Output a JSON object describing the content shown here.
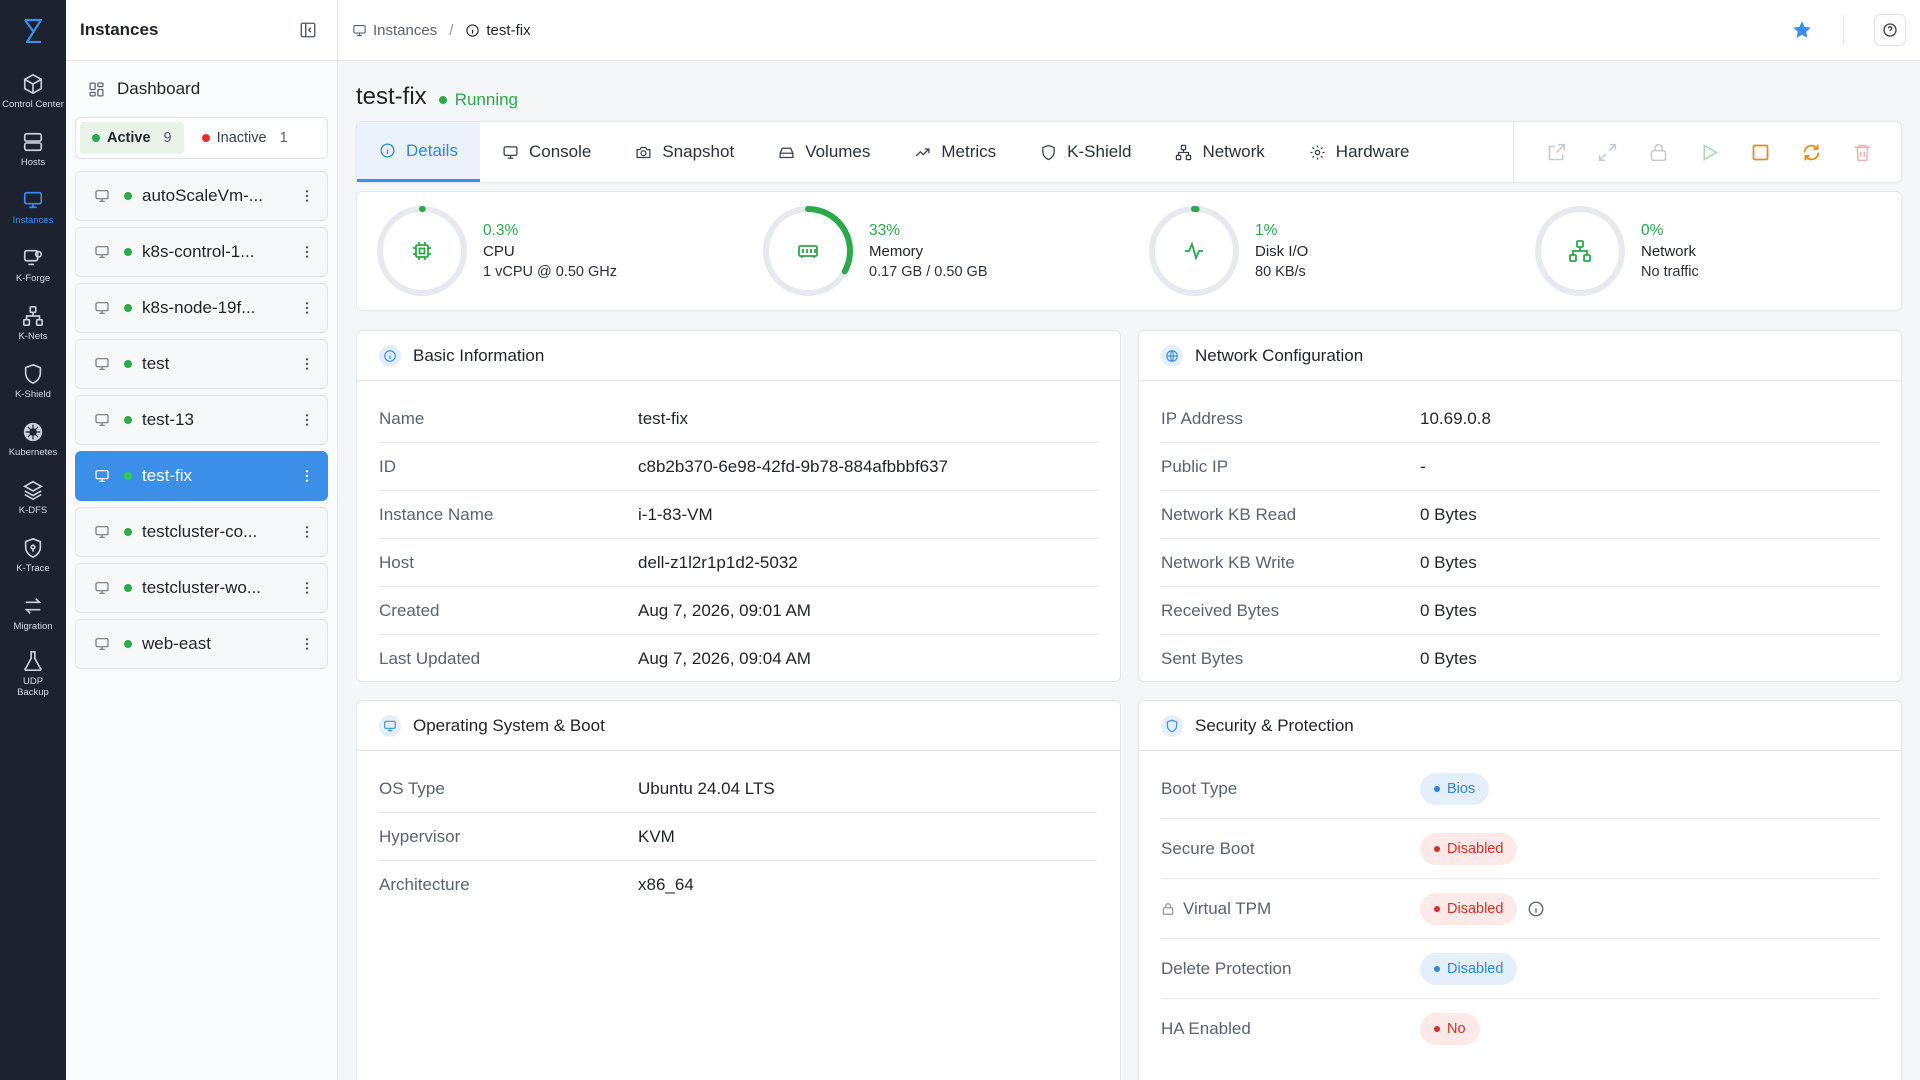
{
  "rail": {
    "items": [
      {
        "label": "Control Center",
        "icon": "cube-icon"
      },
      {
        "label": "Hosts",
        "icon": "server-icon"
      },
      {
        "label": "Instances",
        "icon": "monitor-icon",
        "active": true
      },
      {
        "label": "K-Forge",
        "icon": "forge-icon"
      },
      {
        "label": "K-Nets",
        "icon": "network-icon"
      },
      {
        "label": "K-Shield",
        "icon": "shield-icon"
      },
      {
        "label": "Kubernetes",
        "icon": "kubernetes-icon"
      },
      {
        "label": "K-DFS",
        "icon": "layers-icon"
      },
      {
        "label": "K-Trace",
        "icon": "trace-icon"
      },
      {
        "label": "Migration",
        "icon": "arrows-icon"
      },
      {
        "label": "UDP Backup",
        "icon": "flask-icon"
      }
    ]
  },
  "sidebar": {
    "title": "Instances",
    "dashboard_label": "Dashboard",
    "filters": {
      "active_label": "Active",
      "active_count": "9",
      "inactive_label": "Inactive",
      "inactive_count": "1"
    },
    "instances": [
      {
        "name": "autoScaleVm-..."
      },
      {
        "name": "k8s-control-1..."
      },
      {
        "name": "k8s-node-19f..."
      },
      {
        "name": "test"
      },
      {
        "name": "test-13"
      },
      {
        "name": "test-fix"
      },
      {
        "name": "testcluster-co..."
      },
      {
        "name": "testcluster-wo..."
      },
      {
        "name": "web-east"
      }
    ]
  },
  "breadcrumb": {
    "root": "Instances",
    "separator": "/",
    "current": "test-fix"
  },
  "header": {
    "title": "test-fix",
    "status": "Running"
  },
  "tabs": [
    {
      "label": "Details"
    },
    {
      "label": "Console"
    },
    {
      "label": "Snapshot"
    },
    {
      "label": "Volumes"
    },
    {
      "label": "Metrics"
    },
    {
      "label": "K-Shield"
    },
    {
      "label": "Network"
    },
    {
      "label": "Hardware"
    }
  ],
  "metrics": [
    {
      "pct": "0.3%",
      "label": "CPU",
      "sub": "1 vCPU @ 0.50 GHz",
      "fraction": 0.003
    },
    {
      "pct": "33%",
      "label": "Memory",
      "sub": "0.17 GB / 0.50 GB",
      "fraction": 0.33
    },
    {
      "pct": "1%",
      "label": "Disk I/O",
      "sub": "80 KB/s",
      "fraction": 0.01
    },
    {
      "pct": "0%",
      "label": "Network",
      "sub": "No traffic",
      "fraction": 0
    }
  ],
  "basic": {
    "title": "Basic Information",
    "rows": [
      {
        "k": "Name",
        "v": "test-fix"
      },
      {
        "k": "ID",
        "v": "c8b2b370-6e98-42fd-9b78-884afbbbf637"
      },
      {
        "k": "Instance Name",
        "v": "i-1-83-VM"
      },
      {
        "k": "Host",
        "v": "dell-z1l2r1p1d2-5032"
      },
      {
        "k": "Created",
        "v": "Aug 7, 2026, 09:01 AM"
      },
      {
        "k": "Last Updated",
        "v": "Aug 7, 2026, 09:04 AM"
      }
    ]
  },
  "network": {
    "title": "Network Configuration",
    "rows": [
      {
        "k": "IP Address",
        "v": "10.69.0.8"
      },
      {
        "k": "Public IP",
        "v": "-"
      },
      {
        "k": "Network KB Read",
        "v": "0 Bytes"
      },
      {
        "k": "Network KB Write",
        "v": "0 Bytes"
      },
      {
        "k": "Received Bytes",
        "v": "0 Bytes"
      },
      {
        "k": "Sent Bytes",
        "v": "0 Bytes"
      }
    ]
  },
  "os": {
    "title": "Operating System & Boot",
    "rows": [
      {
        "k": "OS Type",
        "v": "Ubuntu 24.04 LTS"
      },
      {
        "k": "Hypervisor",
        "v": "KVM"
      },
      {
        "k": "Architecture",
        "v": "x86_64"
      }
    ]
  },
  "security": {
    "title": "Security & Protection",
    "rows": [
      {
        "k": "Boot Type",
        "v": "Bios"
      },
      {
        "k": "Secure Boot",
        "v": "Disabled"
      },
      {
        "k": "Virtual TPM",
        "v": "Disabled"
      },
      {
        "k": "Delete Protection",
        "v": "Disabled"
      },
      {
        "k": "HA Enabled",
        "v": "No"
      }
    ]
  },
  "colors": {
    "accent": "#3b8fe6",
    "running": "#2aa84a",
    "danger": "#d92d27",
    "rail_bg": "#1b2230"
  }
}
